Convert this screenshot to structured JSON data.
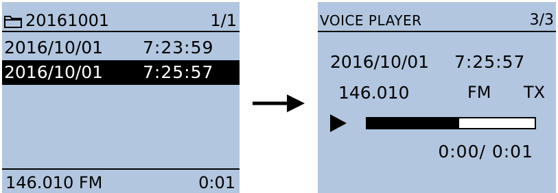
{
  "left_screen": {
    "folder_name": "20161001",
    "page": "1/1",
    "files": [
      {
        "date": "2016/10/01",
        "time": "7:23:59",
        "selected": false
      },
      {
        "date": "2016/10/01",
        "time": "7:25:57",
        "selected": true
      }
    ],
    "footer": {
      "frequency_mode": "146.010 FM",
      "duration": "0:01"
    }
  },
  "right_screen": {
    "title": "VOICE PLAYER",
    "page": "3/3",
    "recording": {
      "date": "2016/10/01",
      "time": "7:25:57",
      "frequency": "146.010",
      "mode": "FM",
      "direction": "TX"
    },
    "playback": {
      "elapsed_total": "0:00/ 0:01",
      "progress_fraction": 0.55
    }
  },
  "icons": {
    "folder": "folder-icon",
    "play": "play-icon",
    "arrow": "right-arrow-icon"
  },
  "colors": {
    "lcd_background": "#b2c6df",
    "foreground": "#000000",
    "highlight_text": "#ffffff"
  }
}
